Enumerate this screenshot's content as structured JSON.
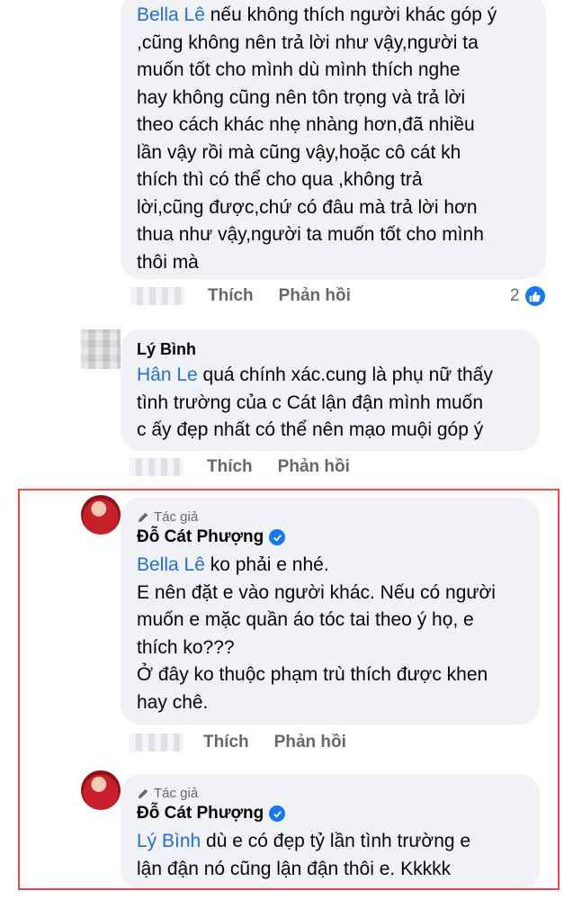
{
  "comment1": {
    "mention": "Bella Lê",
    "text": " nếu không thích người khác góp ý\n,cũng không nên trả lời như vậy,người ta\nmuốn tốt cho mình dù mình thích nghe\nhay không cũng nên tôn trọng và trả lời\ntheo cách khác nhẹ nhàng hơn,đã nhiều\nlần vậy rồi mà cũng vậy,hoặc cô cát kh\nthích thì có thể cho qua ,không trả\nlời,cũng được,chứ có đâu mà trả lời hơn\nthua như vậy,người ta muốn tốt cho mình\nthôi mà",
    "actions": {
      "like": "Thích",
      "reply": "Phản hồi"
    },
    "reaction_count": "2"
  },
  "comment2": {
    "author": "Lý Bình",
    "mention": "Hân Le",
    "text": " quá chính xác.cung là phụ nữ thấy\ntình trường của c Cát lận đận mình muốn\nc ấy đẹp nhất có thể nên mạo muội góp ý",
    "actions": {
      "like": "Thích",
      "reply": "Phản hồi"
    }
  },
  "comment3": {
    "tag": "Tác giả",
    "author": "Đỗ Cát Phượng",
    "mention": "Bella Lê",
    "text": " ko phải e nhé.\nE nên đặt e vào người khác. Nếu có người\nmuốn e mặc quần áo tóc tai theo ý họ, e\nthích ko???\nỞ đây ko thuộc phạm trù thích được khen\nhay chê.",
    "actions": {
      "like": "Thích",
      "reply": "Phản hồi"
    }
  },
  "comment4": {
    "tag": "Tác giả",
    "author": "Đỗ Cát Phượng",
    "mention": "Lý Bình",
    "text": " dù e có đẹp tỷ lần tình trường e\nlận đận nó cũng lận đận thôi e. Kkkkk"
  },
  "colors": {
    "accent": "#1877f2",
    "mention": "#216fdb",
    "highlight_box": "#e64a4a",
    "bubble": "#f0f2f5"
  }
}
